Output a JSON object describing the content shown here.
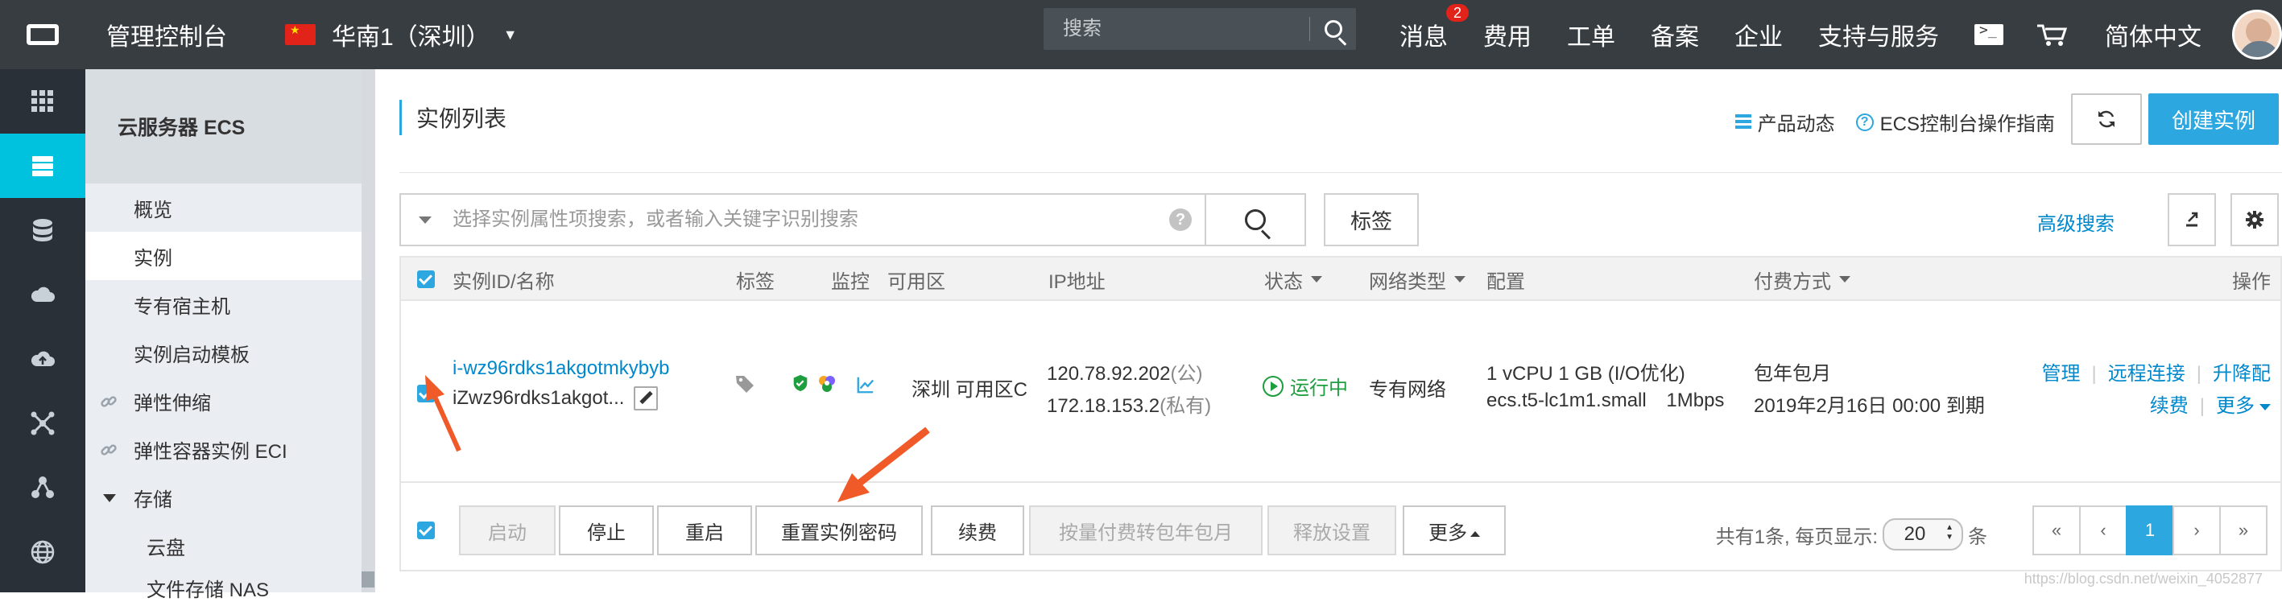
{
  "topbar": {
    "title": "管理控制台",
    "region": "华南1（深圳）",
    "search_placeholder": "搜索",
    "items": [
      "消息",
      "费用",
      "工单",
      "备案",
      "企业",
      "支持与服务"
    ],
    "message_badge": "2",
    "language": "简体中文"
  },
  "leftbar": {
    "icons": [
      "grid-icon",
      "server-icon",
      "database-icon",
      "cloud-icon",
      "cloud-upload-icon",
      "network-icon",
      "cluster-icon",
      "globe-icon"
    ]
  },
  "nav2": {
    "title": "云服务器 ECS",
    "items": [
      {
        "label": "概览"
      },
      {
        "label": "实例",
        "active": true
      },
      {
        "label": "专有宿主机"
      },
      {
        "label": "实例启动模板"
      },
      {
        "label": "弹性伸缩",
        "link": true
      },
      {
        "label": "弹性容器实例 ECI",
        "link": true
      },
      {
        "label": "存储",
        "expand": true
      },
      {
        "label": "云盘",
        "sub": true
      },
      {
        "label": "文件存储 NAS",
        "sub": true
      }
    ]
  },
  "main": {
    "page_title": "实例列表",
    "product_updates": "产品动态",
    "guide": "ECS控制台操作指南",
    "create_button": "创建实例",
    "search_placeholder": "选择实例属性项搜索，或者输入关键字识别搜索",
    "tag_button": "标签",
    "advanced_search": "高级搜索",
    "table": {
      "headers": {
        "id_name": "实例ID/名称",
        "tag": "标签",
        "monitor": "监控",
        "zone": "可用区",
        "ip": "IP地址",
        "status": "状态",
        "network_type": "网络类型",
        "config": "配置",
        "billing": "付费方式",
        "actions": "操作"
      },
      "row": {
        "instance_id": "i-wz96rdks1akgotmkybyb",
        "instance_name": "iZwz96rdks1akgot...",
        "zone": "深圳 可用区C",
        "public_ip": "120.78.92.202",
        "public_suffix": "(公)",
        "private_ip": "172.18.153.2",
        "private_suffix": "(私有)",
        "status": "运行中",
        "network_type": "专有网络",
        "config_line1": "1 vCPU 1 GB (I/O优化)",
        "config_line2": "ecs.t5-lc1m1.small",
        "bandwidth": "1Mbps",
        "billing_line1": "包年包月",
        "billing_line2": "2019年2月16日 00:00 到期",
        "ops": [
          "管理",
          "远程连接",
          "升降配",
          "续费",
          "更多"
        ]
      }
    },
    "footer": {
      "buttons": [
        {
          "label": "启动",
          "disabled": true
        },
        {
          "label": "停止"
        },
        {
          "label": "重启"
        },
        {
          "label": "重置实例密码"
        },
        {
          "label": "续费"
        },
        {
          "label": "按量付费转包年包月",
          "disabled": true
        },
        {
          "label": "释放设置",
          "disabled": true
        },
        {
          "label": "更多"
        }
      ],
      "page_info_prefix": "共有1条, 每页显示:",
      "page_size": "20",
      "page_info_suffix": "条",
      "pager": [
        "«",
        "‹",
        "1",
        "›",
        "»"
      ]
    }
  },
  "watermark": "https://blog.csdn.net/weixin_4052877",
  "colors": {
    "accent": "#0088cc",
    "primary_button": "#2ca7e0",
    "running": "#1e9e3e",
    "annotation": "#f05a28"
  }
}
